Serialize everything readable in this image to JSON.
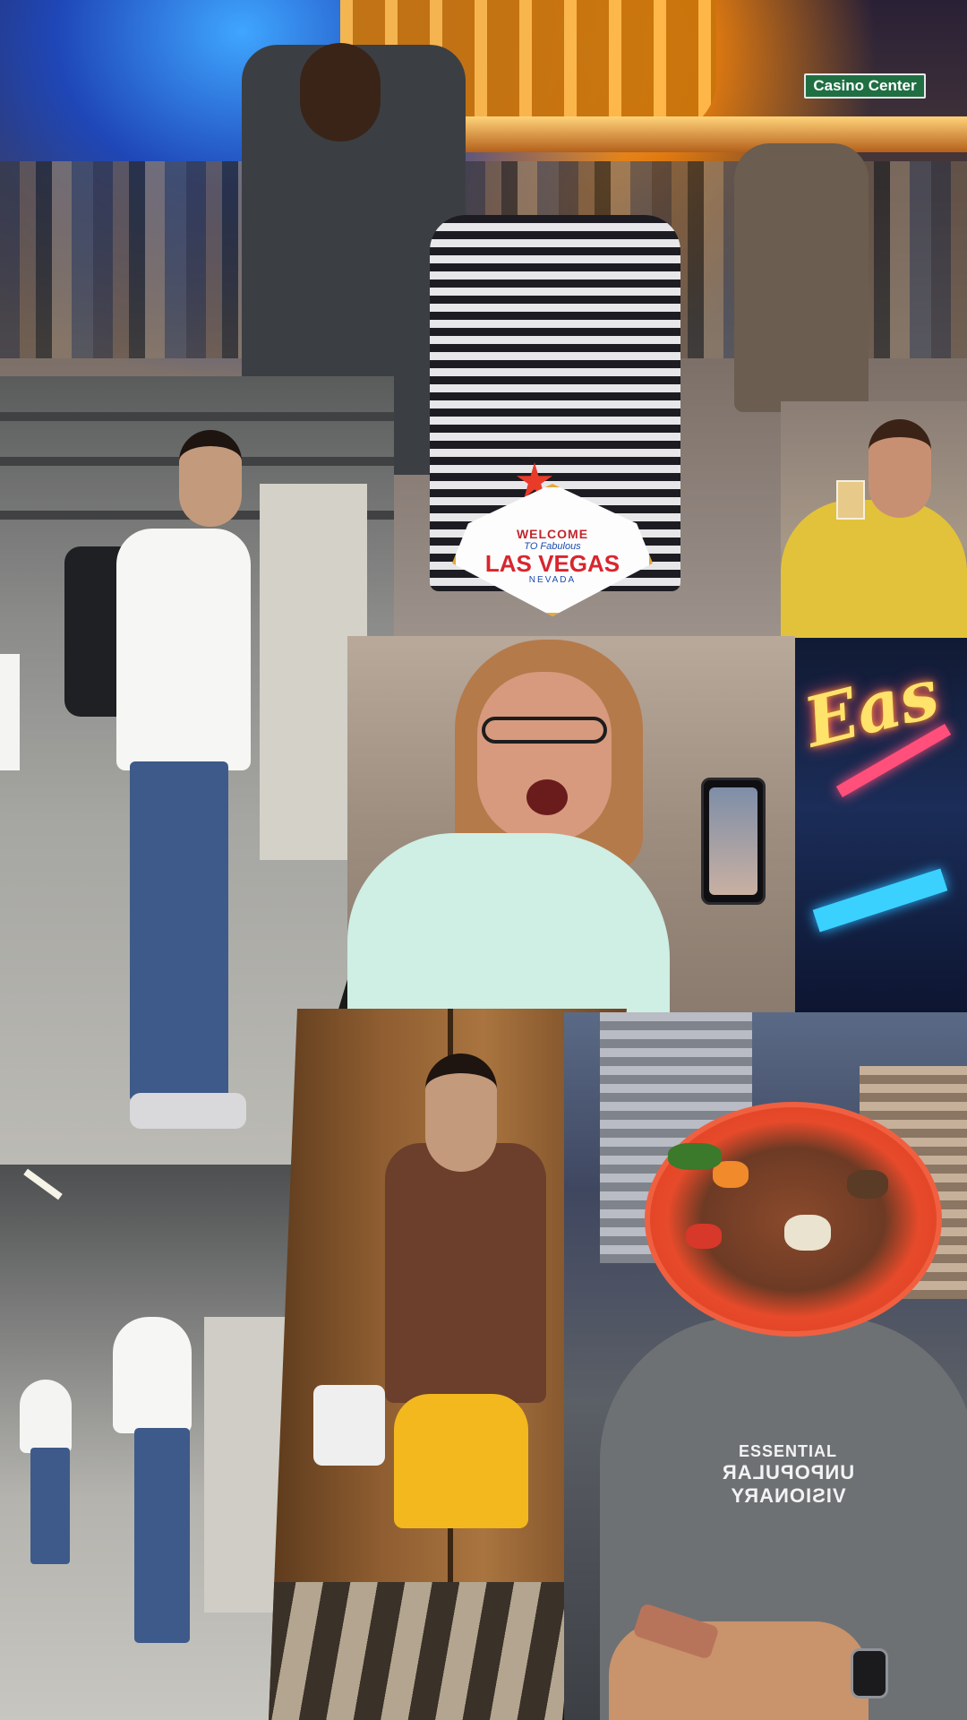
{
  "street_sign": {
    "text": "Casino Center"
  },
  "vegas_sign": {
    "welcome": "WELCOME",
    "to_fabulous": "TO Fabulous",
    "las_vegas": "LAS VEGAS",
    "nevada": "NEVADA"
  },
  "neon_sign": {
    "text": "Eas"
  },
  "tshirt_print": {
    "line1": "ESSENTIAL",
    "line2": "UNPOPULAR VISIONARY"
  },
  "colors": {
    "street_sign_green": "#1f6f43",
    "neon_yellow": "#ffe36a",
    "plate_red": "#e74a2a",
    "lakers_yellow": "#f2b81e"
  }
}
